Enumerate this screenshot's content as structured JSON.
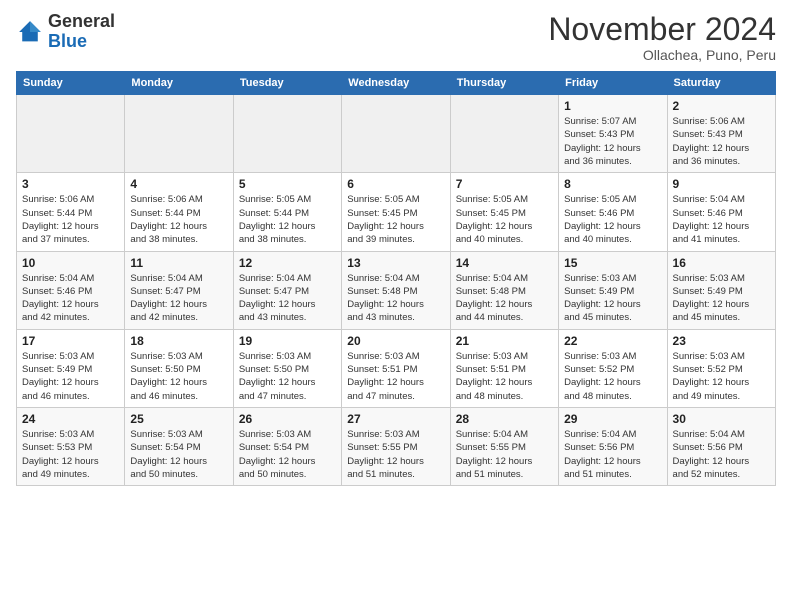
{
  "logo": {
    "general": "General",
    "blue": "Blue"
  },
  "header": {
    "title": "November 2024",
    "subtitle": "Ollachea, Puno, Peru"
  },
  "weekdays": [
    "Sunday",
    "Monday",
    "Tuesday",
    "Wednesday",
    "Thursday",
    "Friday",
    "Saturday"
  ],
  "weeks": [
    [
      {
        "day": "",
        "info": ""
      },
      {
        "day": "",
        "info": ""
      },
      {
        "day": "",
        "info": ""
      },
      {
        "day": "",
        "info": ""
      },
      {
        "day": "",
        "info": ""
      },
      {
        "day": "1",
        "info": "Sunrise: 5:07 AM\nSunset: 5:43 PM\nDaylight: 12 hours\nand 36 minutes."
      },
      {
        "day": "2",
        "info": "Sunrise: 5:06 AM\nSunset: 5:43 PM\nDaylight: 12 hours\nand 36 minutes."
      }
    ],
    [
      {
        "day": "3",
        "info": "Sunrise: 5:06 AM\nSunset: 5:44 PM\nDaylight: 12 hours\nand 37 minutes."
      },
      {
        "day": "4",
        "info": "Sunrise: 5:06 AM\nSunset: 5:44 PM\nDaylight: 12 hours\nand 38 minutes."
      },
      {
        "day": "5",
        "info": "Sunrise: 5:05 AM\nSunset: 5:44 PM\nDaylight: 12 hours\nand 38 minutes."
      },
      {
        "day": "6",
        "info": "Sunrise: 5:05 AM\nSunset: 5:45 PM\nDaylight: 12 hours\nand 39 minutes."
      },
      {
        "day": "7",
        "info": "Sunrise: 5:05 AM\nSunset: 5:45 PM\nDaylight: 12 hours\nand 40 minutes."
      },
      {
        "day": "8",
        "info": "Sunrise: 5:05 AM\nSunset: 5:46 PM\nDaylight: 12 hours\nand 40 minutes."
      },
      {
        "day": "9",
        "info": "Sunrise: 5:04 AM\nSunset: 5:46 PM\nDaylight: 12 hours\nand 41 minutes."
      }
    ],
    [
      {
        "day": "10",
        "info": "Sunrise: 5:04 AM\nSunset: 5:46 PM\nDaylight: 12 hours\nand 42 minutes."
      },
      {
        "day": "11",
        "info": "Sunrise: 5:04 AM\nSunset: 5:47 PM\nDaylight: 12 hours\nand 42 minutes."
      },
      {
        "day": "12",
        "info": "Sunrise: 5:04 AM\nSunset: 5:47 PM\nDaylight: 12 hours\nand 43 minutes."
      },
      {
        "day": "13",
        "info": "Sunrise: 5:04 AM\nSunset: 5:48 PM\nDaylight: 12 hours\nand 43 minutes."
      },
      {
        "day": "14",
        "info": "Sunrise: 5:04 AM\nSunset: 5:48 PM\nDaylight: 12 hours\nand 44 minutes."
      },
      {
        "day": "15",
        "info": "Sunrise: 5:03 AM\nSunset: 5:49 PM\nDaylight: 12 hours\nand 45 minutes."
      },
      {
        "day": "16",
        "info": "Sunrise: 5:03 AM\nSunset: 5:49 PM\nDaylight: 12 hours\nand 45 minutes."
      }
    ],
    [
      {
        "day": "17",
        "info": "Sunrise: 5:03 AM\nSunset: 5:49 PM\nDaylight: 12 hours\nand 46 minutes."
      },
      {
        "day": "18",
        "info": "Sunrise: 5:03 AM\nSunset: 5:50 PM\nDaylight: 12 hours\nand 46 minutes."
      },
      {
        "day": "19",
        "info": "Sunrise: 5:03 AM\nSunset: 5:50 PM\nDaylight: 12 hours\nand 47 minutes."
      },
      {
        "day": "20",
        "info": "Sunrise: 5:03 AM\nSunset: 5:51 PM\nDaylight: 12 hours\nand 47 minutes."
      },
      {
        "day": "21",
        "info": "Sunrise: 5:03 AM\nSunset: 5:51 PM\nDaylight: 12 hours\nand 48 minutes."
      },
      {
        "day": "22",
        "info": "Sunrise: 5:03 AM\nSunset: 5:52 PM\nDaylight: 12 hours\nand 48 minutes."
      },
      {
        "day": "23",
        "info": "Sunrise: 5:03 AM\nSunset: 5:52 PM\nDaylight: 12 hours\nand 49 minutes."
      }
    ],
    [
      {
        "day": "24",
        "info": "Sunrise: 5:03 AM\nSunset: 5:53 PM\nDaylight: 12 hours\nand 49 minutes."
      },
      {
        "day": "25",
        "info": "Sunrise: 5:03 AM\nSunset: 5:54 PM\nDaylight: 12 hours\nand 50 minutes."
      },
      {
        "day": "26",
        "info": "Sunrise: 5:03 AM\nSunset: 5:54 PM\nDaylight: 12 hours\nand 50 minutes."
      },
      {
        "day": "27",
        "info": "Sunrise: 5:03 AM\nSunset: 5:55 PM\nDaylight: 12 hours\nand 51 minutes."
      },
      {
        "day": "28",
        "info": "Sunrise: 5:04 AM\nSunset: 5:55 PM\nDaylight: 12 hours\nand 51 minutes."
      },
      {
        "day": "29",
        "info": "Sunrise: 5:04 AM\nSunset: 5:56 PM\nDaylight: 12 hours\nand 51 minutes."
      },
      {
        "day": "30",
        "info": "Sunrise: 5:04 AM\nSunset: 5:56 PM\nDaylight: 12 hours\nand 52 minutes."
      }
    ]
  ]
}
